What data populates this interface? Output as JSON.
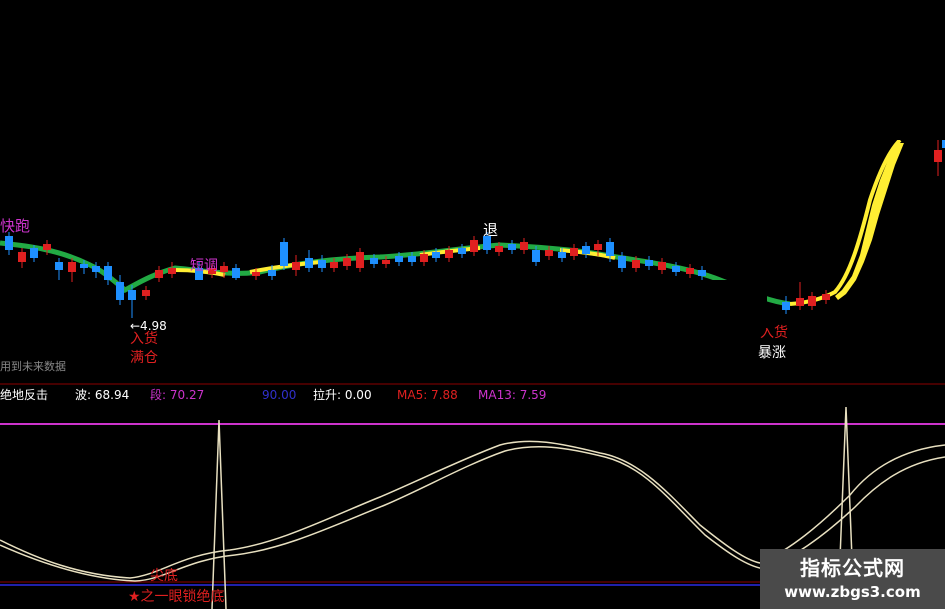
{
  "colors": {
    "background": "#000000",
    "up_candle": "#e02020",
    "down_candle": "#1e90ff",
    "ma_green": "#22aa44",
    "ma_yellow": "#ffee33",
    "grid_red": "#8b0000",
    "magenta": "#cc33cc",
    "kdj_line": "#e8e0c0",
    "signal_text": "#e02020"
  },
  "main": {
    "label_kuaipao": "快跑",
    "label_duantiao": "短调",
    "label_tui": "退",
    "label_low_price": "←4.98",
    "label_ruhuo_left": "入货",
    "label_mancang": "满仓",
    "label_ruhuo_right": "入货",
    "label_baozhang": "暴涨",
    "label_future_data": "用到未来数据"
  },
  "info_bar": {
    "name": "绝地反击",
    "bo_label": "波: 68.94",
    "duan_label": "段: 70.27",
    "ninety": "90.00",
    "lasheng_label": "拉升: 0.00",
    "ma5_label": "MA5: 7.88",
    "ma13_label": "MA13: 7.59"
  },
  "indicator": {
    "label_jiandi": "尖底",
    "label_star_text": "★之一眼锁绝底"
  },
  "watermark": {
    "title": "指标公式网",
    "url": "www.zbgs3.com"
  }
}
